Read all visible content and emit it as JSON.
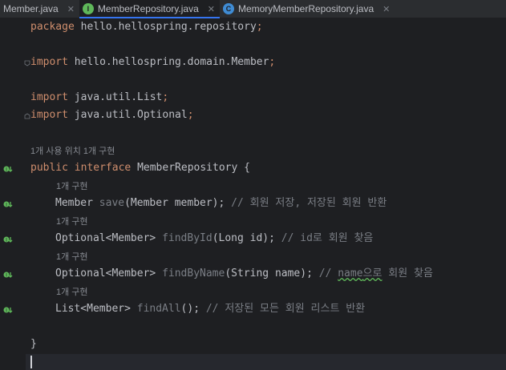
{
  "tabs": [
    {
      "label": "Member.java",
      "icon": "none",
      "active": false
    },
    {
      "label": "MemberRepository.java",
      "icon": "interface-file-icon",
      "icon_letter": "I",
      "active": true
    },
    {
      "label": "MemoryMemberRepository.java",
      "icon": "class-file-icon",
      "icon_letter": "C",
      "active": false
    }
  ],
  "tab_close_glyph": "✕",
  "code": {
    "package_kw": "package",
    "package_name": " hello.hellospring.repository",
    "semi": ";",
    "import_kw": "import",
    "import1": " hello.hellospring.domain.Member",
    "import2": " java.util.List",
    "import3": " java.util.Optional",
    "interface_hint": "1개 사용 위치   1개 구현",
    "public_kw": "public",
    "interface_kw": "interface",
    "interface_name": " MemberRepository {",
    "method_hint": "1개 구현",
    "m1_type": "Member ",
    "m1_name": "save",
    "m1_params": "(Member member); ",
    "m1_comment": "// 회원 저장, 저장된 회원 반환",
    "m2_type": "Optional<Member> ",
    "m2_name": "findById",
    "m2_params": "(Long id); ",
    "m2_comment": "// id로 회원 찾음",
    "m3_type": "Optional<Member> ",
    "m3_name": "findByName",
    "m3_params": "(String name); ",
    "m3_comment_pre": "// ",
    "m3_comment_typo": "name",
    "m3_comment_typo2": "으로",
    "m3_comment_post": " 회원 찾음",
    "m4_type": "List<Member> ",
    "m4_name": "findAll",
    "m4_params": "(); ",
    "m4_comment": "// 저장된 모든 회원 리스트 반환",
    "close_brace": "}"
  },
  "colors": {
    "keyword": "#cf8e6d",
    "method": "#56a8f5",
    "comment": "#7a7e85",
    "implemented_gutter": "#5fb85a"
  }
}
